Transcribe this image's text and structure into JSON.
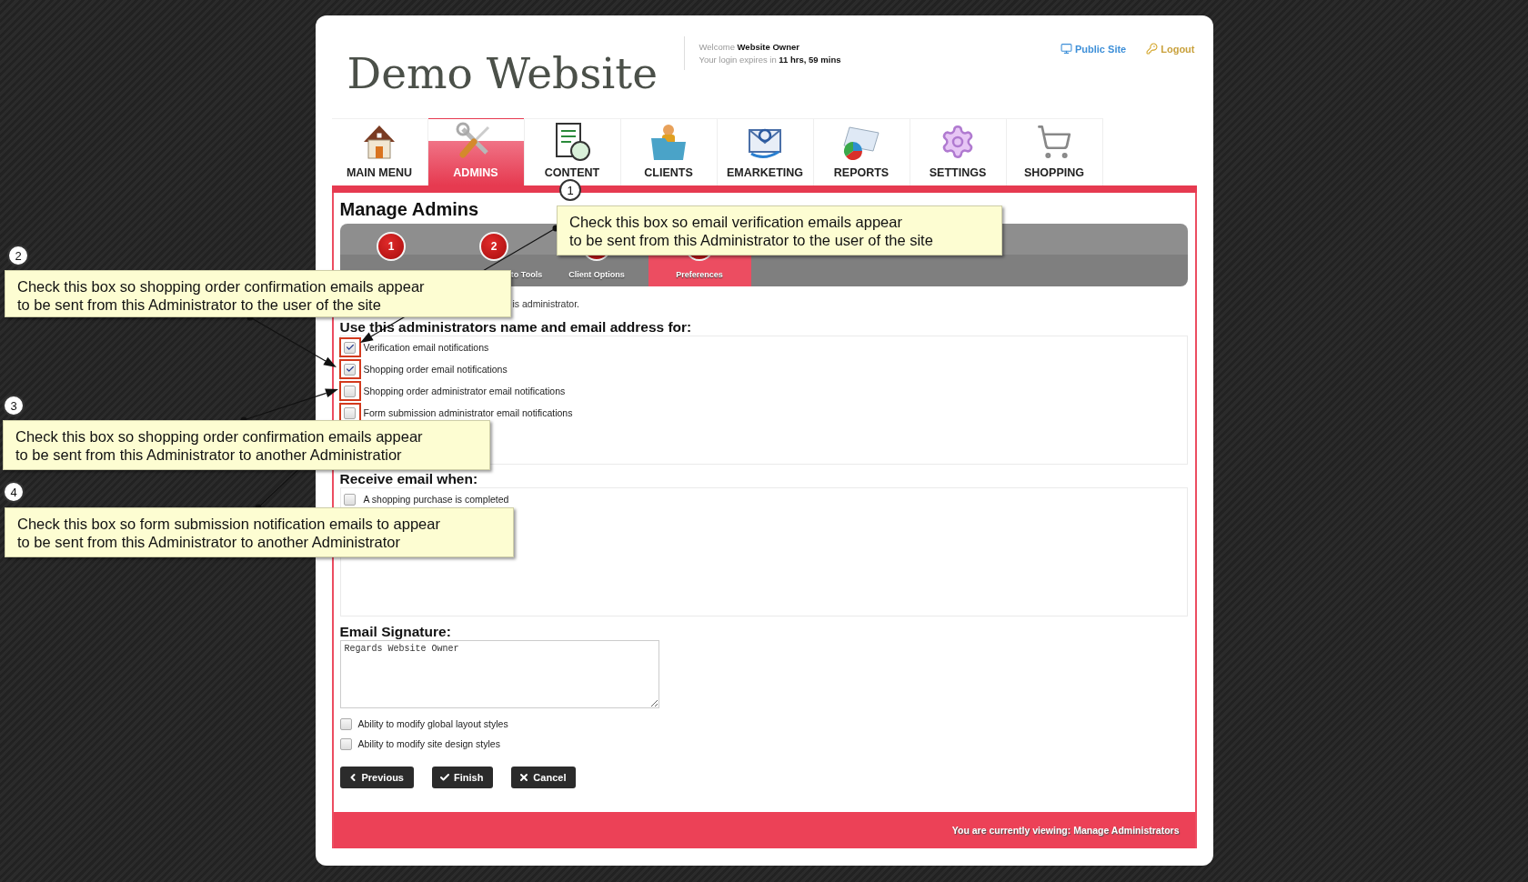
{
  "header": {
    "logo": "Demo Website",
    "welcome_prefix": "Welcome",
    "user": "Website Owner",
    "expiry_prefix": "Your login expires in",
    "expiry": "11 hrs, 59 mins",
    "links": [
      {
        "label": "Public Site"
      },
      {
        "label": "Logout"
      }
    ]
  },
  "nav": [
    {
      "label": "MAIN MENU",
      "selected": false
    },
    {
      "label": "ADMINS",
      "selected": true
    },
    {
      "label": "CONTENT",
      "selected": false
    },
    {
      "label": "CLIENTS",
      "selected": false
    },
    {
      "label": "EMARKETING",
      "selected": false
    },
    {
      "label": "REPORTS",
      "selected": false
    },
    {
      "label": "SETTINGS",
      "selected": false
    },
    {
      "label": "SHOPPING",
      "selected": false
    }
  ],
  "page_title": "Manage Admins",
  "wizard": [
    {
      "number": "1",
      "selected": false
    },
    {
      "number": "2",
      "label": "to Tools",
      "selected": false
    },
    {
      "label": "Client Options",
      "selected": false
    },
    {
      "label": "Preferences",
      "selected": true
    }
  ],
  "intro": "is administrator.",
  "sections": [
    {
      "heading": "Use this administrators name and email address for:",
      "options": [
        {
          "label": "Verification email notifications",
          "checked": true,
          "highlighted": true
        },
        {
          "label": "Shopping order email notifications",
          "checked": true,
          "highlighted": true
        },
        {
          "label": "Shopping order administrator email notifications",
          "checked": false,
          "highlighted": true
        },
        {
          "label": "Form submission administrator email notifications",
          "checked": false,
          "highlighted": true
        }
      ]
    },
    {
      "heading": "Receive email when:",
      "options": [
        {
          "label": "A shopping purchase is completed",
          "checked": false,
          "highlighted": false
        }
      ]
    }
  ],
  "signature": {
    "label": "Email Signature:",
    "value": "Regards Website Owner"
  },
  "permissions": [
    {
      "label": "Ability to modify global layout styles",
      "checked": false
    },
    {
      "label": "Ability to modify site design styles",
      "checked": false
    }
  ],
  "buttons": [
    {
      "label": "Previous",
      "kind": "back"
    },
    {
      "label": "Finish",
      "kind": "finish"
    },
    {
      "label": "Cancel",
      "kind": "cancel"
    }
  ],
  "footer": "You are currently viewing: Manage Administrators",
  "callouts": [
    {
      "number": "1",
      "text": "Check this box so email verification emails appear\nto be sent from this Administrator to the user of the site"
    },
    {
      "number": "2",
      "text": "Check this box so shopping order confirmation emails appear\nto be sent from this Administrator to the user of the site"
    },
    {
      "number": "3",
      "text": "Check this box so shopping order confirmation emails appear\nto be sent from this Administrator to another Administratior"
    },
    {
      "number": "4",
      "text": "Check this box so form submission notification emails to appear\nto be sent from this Administrator to another Administrator"
    }
  ]
}
